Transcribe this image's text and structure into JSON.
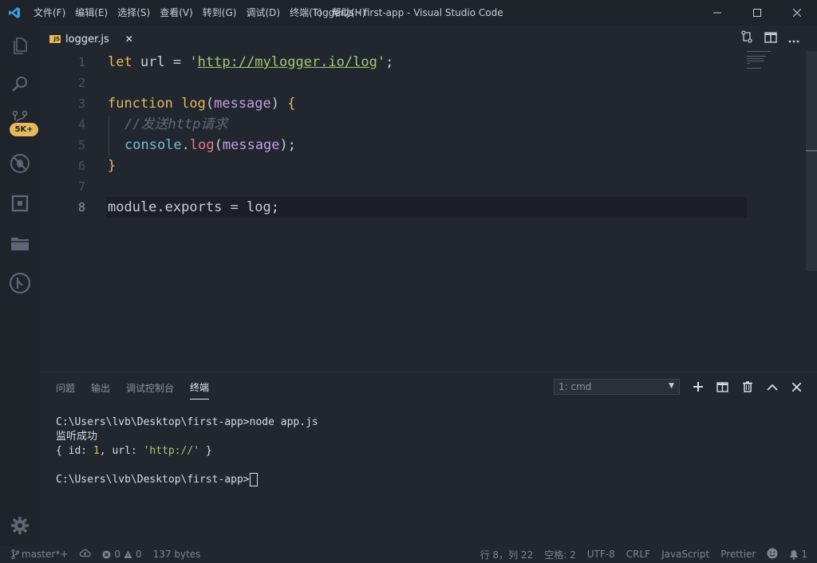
{
  "window": {
    "title": "logger.js - first-app - Visual Studio Code"
  },
  "menu": [
    {
      "label": "文件(F)"
    },
    {
      "label": "编辑(E)"
    },
    {
      "label": "选择(S)"
    },
    {
      "label": "查看(V)"
    },
    {
      "label": "转到(G)"
    },
    {
      "label": "调试(D)"
    },
    {
      "label": "终端(T)"
    },
    {
      "label": "帮助(H)"
    }
  ],
  "activity": {
    "scm_badge": "5K+",
    "icons": [
      "explorer-icon",
      "search-icon",
      "source-control-icon",
      "debug-icon",
      "extensions-icon",
      "folder-icon",
      "git-graph-icon",
      "gear-icon"
    ]
  },
  "tab": {
    "label": "logger.js",
    "icon_text": "JS",
    "close": "✕"
  },
  "editor": {
    "line_numbers": [
      "1",
      "2",
      "3",
      "4",
      "5",
      "6",
      "7",
      "8"
    ],
    "lines": {
      "l1": {
        "kw": "let",
        "sp1": " ",
        "id": "url",
        "op": " = ",
        "q1": "'",
        "str": "http://mylogger.io/log",
        "q2": "'",
        "end": ";"
      },
      "l3": {
        "kw": "function",
        "sp": " ",
        "fn": "log",
        "p1": "(",
        "param": "message",
        "p2": ")",
        "sp2": " ",
        "brace": "{"
      },
      "l4": {
        "cmt": "//发送http请求"
      },
      "l5": {
        "obj": "console",
        "dot": ".",
        "meth": "log",
        "p1": "(",
        "param": "message",
        "p2": ")",
        "end": ";"
      },
      "l6": {
        "brace": "}"
      },
      "l8": {
        "obj": "module",
        "dot": ".",
        "prop": "exports",
        "op": " = ",
        "id": "log",
        "end": ";"
      }
    }
  },
  "panel": {
    "tabs": [
      {
        "label": "问题"
      },
      {
        "label": "输出"
      },
      {
        "label": "调试控制台"
      },
      {
        "label": "终端"
      }
    ],
    "terminal_select": "1: cmd",
    "terminal_lines": {
      "t1": "C:\\Users\\lvb\\Desktop\\first-app>node app.js",
      "t2": "监听成功",
      "t3": {
        "a": "{ id: ",
        "num": "1",
        "b": ", url: ",
        "str": "'http://'",
        "c": " }"
      },
      "t5": "C:\\Users\\lvb\\Desktop\\first-app>"
    }
  },
  "status": {
    "branch": "master*+",
    "errors": "0",
    "warnings": "0",
    "size": "137 bytes",
    "position": "行 8，列 22",
    "spaces": "空格: 2",
    "encoding": "UTF-8",
    "eol": "CRLF",
    "language": "JavaScript",
    "formatter": "Prettier",
    "notifications": "1"
  },
  "colors": {
    "background": "#22262e",
    "accent_yellow": "#e6b85c",
    "string_green": "#9fcb72"
  }
}
